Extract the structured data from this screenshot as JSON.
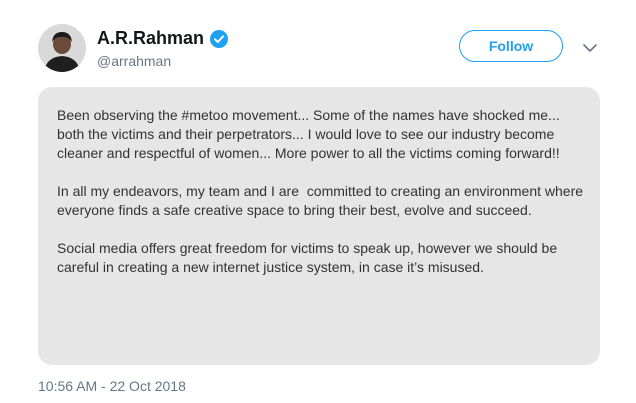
{
  "user": {
    "display_name": "A.R.Rahman",
    "handle": "@arrahman",
    "verified": true,
    "avatar_icon": "profile-photo",
    "verified_icon": "verified-badge-icon"
  },
  "actions": {
    "follow_label": "Follow",
    "more_icon": "chevron-down-icon"
  },
  "tweet": {
    "paragraphs": [
      "Been observing the #metoo movement... Some of the names have shocked me... both the victims and their perpetrators... I would love to see our industry become cleaner and respectful of women... More power to all the victims coming forward!!",
      "In all my endeavors, my team and I are  committed to creating an environment where everyone finds a safe creative space to bring their best, evolve and succeed.",
      "Social media offers great freedom for victims to speak up, however we should be careful in creating a new internet justice system, in case it’s misused."
    ],
    "timestamp": "10:56 AM - 22 Oct 2018"
  },
  "colors": {
    "accent": "#1da1f2",
    "card_background": "#e6e6e6",
    "secondary_text": "#657786"
  }
}
